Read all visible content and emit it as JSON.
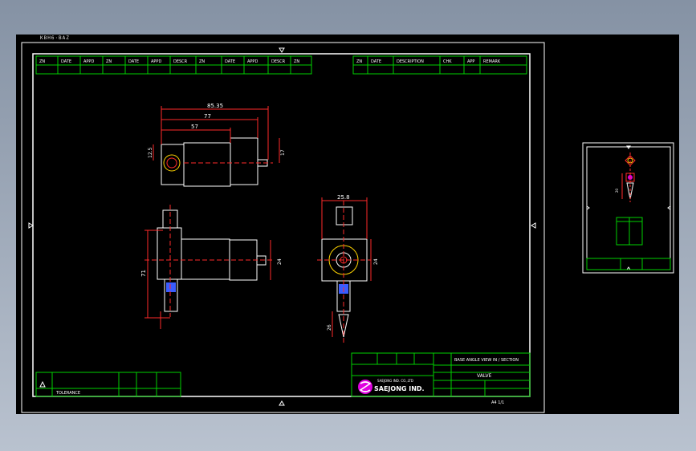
{
  "viewport": {
    "corner_label": "KBH6·BAZ",
    "background": "#000000"
  },
  "colors": {
    "white": "#ffffff",
    "green": "#00d000",
    "red": "#ff2a2a",
    "yellow": "#ffd400",
    "magenta": "#e000e0",
    "blue": "#3a5cff"
  },
  "dimensions": {
    "d1": "85.35",
    "d2": "77",
    "d3": "57",
    "d4": "12.5",
    "d5": "17",
    "d6": "71",
    "d7": "24",
    "d8": "25.8",
    "d9": "24",
    "d10": "26",
    "d11": "20"
  },
  "title_block": {
    "part_name": "VALVE",
    "company_name": "SAEJONG IND.",
    "company_sub": "SAEJONG IND. CO.,LTD",
    "note": "BASE ANGLE  VIEW IN  / SECTION",
    "sheet": "A4 1/1"
  },
  "header_cells_left": [
    "ZN",
    "DATE",
    "APPD",
    "ZN",
    "DATE",
    "APPD",
    "DESCR",
    "ZN",
    "DATE",
    "APPD",
    "DESCR",
    "ZN"
  ],
  "header_cells_right": [
    "ZN",
    "DATE",
    "DESCRIPTION",
    "CHK",
    "APP",
    "REMARK"
  ],
  "revision_block": {
    "label": "TOLERANCE"
  }
}
